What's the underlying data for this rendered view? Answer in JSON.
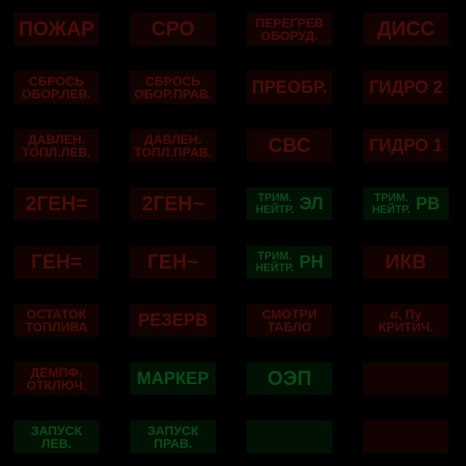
{
  "annunciators": {
    "r1": [
      "ПОЖАР",
      "СРО",
      "ПЕРЕГРЕВ\nОБОРУД.",
      "ДИСС"
    ],
    "r2": [
      "СБРОСЬ\nОБОР.ЛЕВ.",
      "СБРОСЬ\nОБОР.ПРАВ.",
      "ПРЕОБР.",
      "ГИДРО 2"
    ],
    "r3": [
      "ДАВЛЕН.\nТОПЛ.ЛЕВ.",
      "ДАВЛЕН.\nТОПЛ.ПРАВ.",
      "СВС",
      "ГИДРО 1"
    ],
    "r4": [
      "2ГЕН=",
      "2ГЕН~",
      {
        "small": "ТРИМ.\nНЕЙТР.",
        "big": "ЭЛ"
      },
      {
        "small": "ТРИМ.\nНЕЙТР.",
        "big": "РВ"
      }
    ],
    "r5": [
      "ГЕН=",
      "ГЕН~",
      {
        "small": "ТРИМ.\nНЕЙТР.",
        "big": "РН"
      },
      "ИКВ"
    ],
    "r6": [
      "ОСТАТОК\nТОПЛИВА",
      "РЕЗЕРВ",
      "СМОТРИ\nТАБЛО",
      "α, Пу\nКРИТИЧ."
    ],
    "r7": [
      "ДЕМПФ.\nОТКЛЮЧ.",
      "МАРКЕР",
      "ОЭП",
      ""
    ],
    "r8": [
      "ЗАПУСК\nЛЕВ.",
      "ЗАПУСК\nПРАВ.",
      "",
      ""
    ]
  },
  "colors": {
    "red_off_bg": "#120302",
    "red_off_text": "#4a0c06",
    "green_off_bg": "#011204",
    "green_off_text": "#0b4a17"
  }
}
